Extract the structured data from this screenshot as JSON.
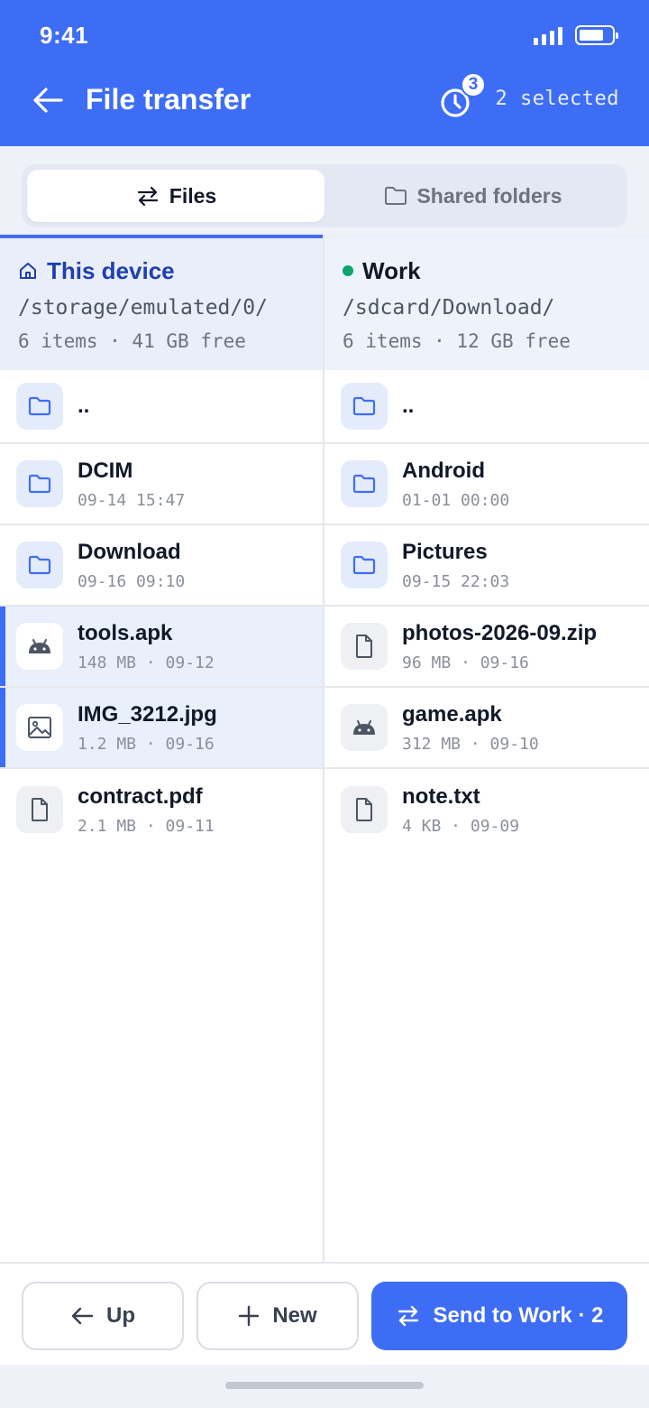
{
  "status_bar": {
    "time": "9:41"
  },
  "header": {
    "title": "File transfer",
    "history_badge": "3",
    "selected_label": "2 selected"
  },
  "tabs": [
    {
      "label": "Files",
      "active": true,
      "icon": "transfer-arrows-icon"
    },
    {
      "label": "Shared folders",
      "active": false,
      "icon": "folder-icon"
    }
  ],
  "left_pane": {
    "name": "This device",
    "icon": "home-icon",
    "path": "/storage/emulated/0/",
    "meta": "6 items · 41 GB free",
    "rows": [
      {
        "name": "..",
        "sub": "",
        "icon": "folder-icon"
      },
      {
        "name": "DCIM",
        "sub": "09-14 15:47",
        "icon": "folder-icon"
      },
      {
        "name": "Download",
        "sub": "09-16 09:10",
        "icon": "folder-icon"
      },
      {
        "name": "tools.apk",
        "sub": "148 MB · 09-12",
        "icon": "android-icon",
        "selected": true
      },
      {
        "name": "IMG_3212.jpg",
        "sub": "1.2 MB · 09-16",
        "icon": "image-icon",
        "selected": true
      },
      {
        "name": "contract.pdf",
        "sub": "2.1 MB · 09-11",
        "icon": "file-icon"
      }
    ]
  },
  "right_pane": {
    "name": "Work",
    "status_color": "#10a36a",
    "path": "/sdcard/Download/",
    "meta": "6 items · 12 GB free",
    "rows": [
      {
        "name": "..",
        "sub": "",
        "icon": "folder-icon"
      },
      {
        "name": "Android",
        "sub": "01-01 00:00",
        "icon": "folder-icon"
      },
      {
        "name": "Pictures",
        "sub": "09-15 22:03",
        "icon": "folder-icon"
      },
      {
        "name": "photos-2026-09.zip",
        "sub": "96 MB · 09-16",
        "icon": "file-icon"
      },
      {
        "name": "game.apk",
        "sub": "312 MB · 09-10",
        "icon": "android-icon"
      },
      {
        "name": "note.txt",
        "sub": "4 KB · 09-09",
        "icon": "file-icon"
      }
    ]
  },
  "bottom_bar": {
    "up_label": "Up",
    "new_label": "New",
    "send_label": "Send to Work · 2"
  },
  "colors": {
    "accent": "#3e6df5",
    "selected_row": "#e9effb"
  }
}
